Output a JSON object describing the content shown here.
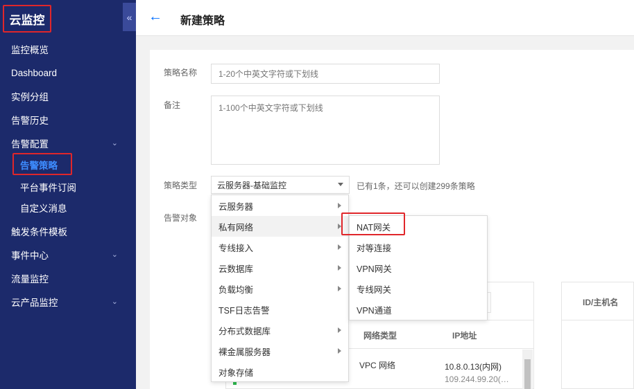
{
  "sidebar": {
    "brand": "云监控",
    "collapse_icon": "«",
    "items": [
      {
        "label": "监控概览"
      },
      {
        "label": "Dashboard"
      },
      {
        "label": "实例分组"
      },
      {
        "label": "告警历史"
      },
      {
        "label": "告警配置",
        "chevron": "⌄"
      },
      {
        "label": "告警策略"
      },
      {
        "label": "平台事件订阅"
      },
      {
        "label": "自定义消息"
      },
      {
        "label": "触发条件模板"
      },
      {
        "label": "事件中心",
        "chevron": "⌄"
      },
      {
        "label": "流量监控"
      },
      {
        "label": "云产品监控",
        "chevron": "⌄"
      }
    ]
  },
  "header": {
    "back_icon": "←",
    "title": "新建策略"
  },
  "form": {
    "name_label": "策略名称",
    "name_placeholder": "1-20个中英文字符或下划线",
    "remark_label": "备注",
    "remark_placeholder": "1-100个中英文字符或下划线",
    "type_label": "策略类型",
    "type_value": "云服务器-基础监控",
    "type_hint": "已有1条，还可以创建299条策略",
    "target_label": "告警对象"
  },
  "menu": {
    "items": [
      "云服务器",
      "私有网络",
      "专线接入",
      "云数据库",
      "负载均衡",
      "TSF日志告警",
      "分布式数据库",
      "裸金属服务器",
      "对象存储"
    ]
  },
  "submenu": {
    "items": [
      "NAT网关",
      "对等连接",
      "VPN网关",
      "专线网关",
      "VPN通道"
    ]
  },
  "table": {
    "col_network_type": "网络类型",
    "col_ip": "IP地址",
    "col_id": "ID/主机名",
    "row1_network": "VPC 网络",
    "row1_ip_inner": "10.8.0.13(内网)",
    "row1_ip_outer": "109.244.99.20(…"
  },
  "colors": {
    "sidebar_bg": "#1c2a6b",
    "accent": "#006eff",
    "highlight_box": "#e0262a"
  }
}
